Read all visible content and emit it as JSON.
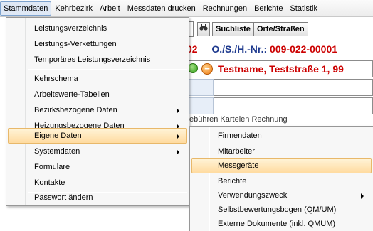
{
  "menubar": {
    "items": [
      {
        "label": "Stammdaten",
        "active": true
      },
      {
        "label": "Kehrbezirk"
      },
      {
        "label": "Arbeit"
      },
      {
        "label": "Messdaten drucken"
      },
      {
        "label": "Rechnungen"
      },
      {
        "label": "Berichte"
      },
      {
        "label": "Statistik"
      }
    ]
  },
  "toolbar": {
    "binocular_icon": "binoculars-icon",
    "suchliste_label": "Suchliste",
    "orte_strassen_label": "Orte/Straßen"
  },
  "record": {
    "left_fragment": "02",
    "id_label": "O./S./H.-Nr.:",
    "id_value": "009-022-00001",
    "address": "Testname, Teststraße 1, 99",
    "tabs_fragment": "ebühren   Karteien   Rechnung"
  },
  "main_menu": {
    "items": [
      {
        "label": "Leistungsverzeichnis"
      },
      {
        "label": "Leistungs-Verkettungen"
      },
      {
        "label": "Temporäres Leistungsverzeichnis"
      },
      {
        "label": "Kehrschema"
      },
      {
        "label": "Arbeitswerte-Tabellen"
      },
      {
        "label": "Bezirksbezogene Daten",
        "submenu": true
      },
      {
        "label": "Heizungsbezogene Daten",
        "submenu": true
      },
      {
        "label": "Eigene Daten",
        "submenu": true,
        "highlighted": true
      },
      {
        "label": "Systemdaten",
        "submenu": true
      },
      {
        "label": "Formulare"
      },
      {
        "label": "Kontakte"
      },
      {
        "label": "Passwort ändern"
      }
    ]
  },
  "sub_menu": {
    "items": [
      {
        "label": "Firmendaten"
      },
      {
        "label": "Mitarbeiter"
      },
      {
        "label": "Messgeräte",
        "highlighted": true
      },
      {
        "label": "Berichte"
      },
      {
        "label": "Verwendungszweck",
        "submenu": true
      },
      {
        "label": "Selbstbewertungsbogen (QM/UM)"
      },
      {
        "label": "Externe Dokumente (inkl. QMUM)"
      }
    ]
  },
  "colors": {
    "highlight": "#ffdba0",
    "record_red": "#cc0000"
  }
}
